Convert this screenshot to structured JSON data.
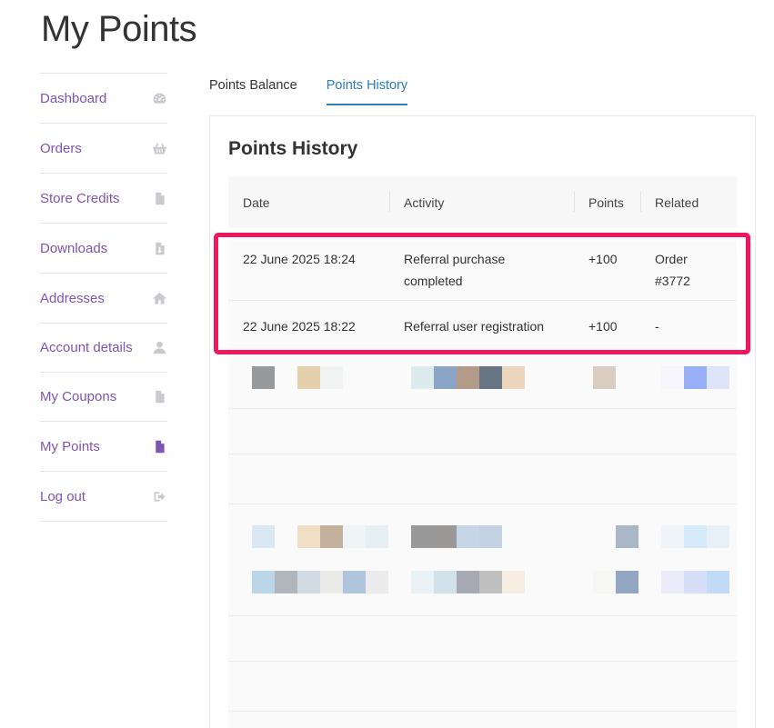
{
  "page": {
    "title": "My Points"
  },
  "sidebar": {
    "items": [
      {
        "label": "Dashboard",
        "icon": "dashboard-icon"
      },
      {
        "label": "Orders",
        "icon": "basket-icon"
      },
      {
        "label": "Store Credits",
        "icon": "document-icon"
      },
      {
        "label": "Downloads",
        "icon": "download-file-icon"
      },
      {
        "label": "Addresses",
        "icon": "home-icon"
      },
      {
        "label": "Account details",
        "icon": "user-icon"
      },
      {
        "label": "My Coupons",
        "icon": "document-icon"
      },
      {
        "label": "My Points",
        "icon": "document-icon",
        "active": true
      },
      {
        "label": "Log out",
        "icon": "logout-icon"
      }
    ]
  },
  "tabs": [
    {
      "label": "Points Balance",
      "active": false
    },
    {
      "label": "Points History",
      "active": true
    }
  ],
  "history": {
    "title": "Points History",
    "columns": [
      "Date",
      "Activity",
      "Points",
      "Related"
    ],
    "rows": [
      {
        "date": "22 June 2025 18:24",
        "activity": "Referral purchase completed",
        "points": "+100",
        "related": "Order #3772"
      },
      {
        "date": "22 June 2025 18:22",
        "activity": "Referral user registration",
        "points": "+100",
        "related": "-"
      }
    ]
  },
  "colors": {
    "accent_purple": "#7f54b3",
    "tab_active": "#2a7fc1",
    "highlight": "#f0175f"
  }
}
